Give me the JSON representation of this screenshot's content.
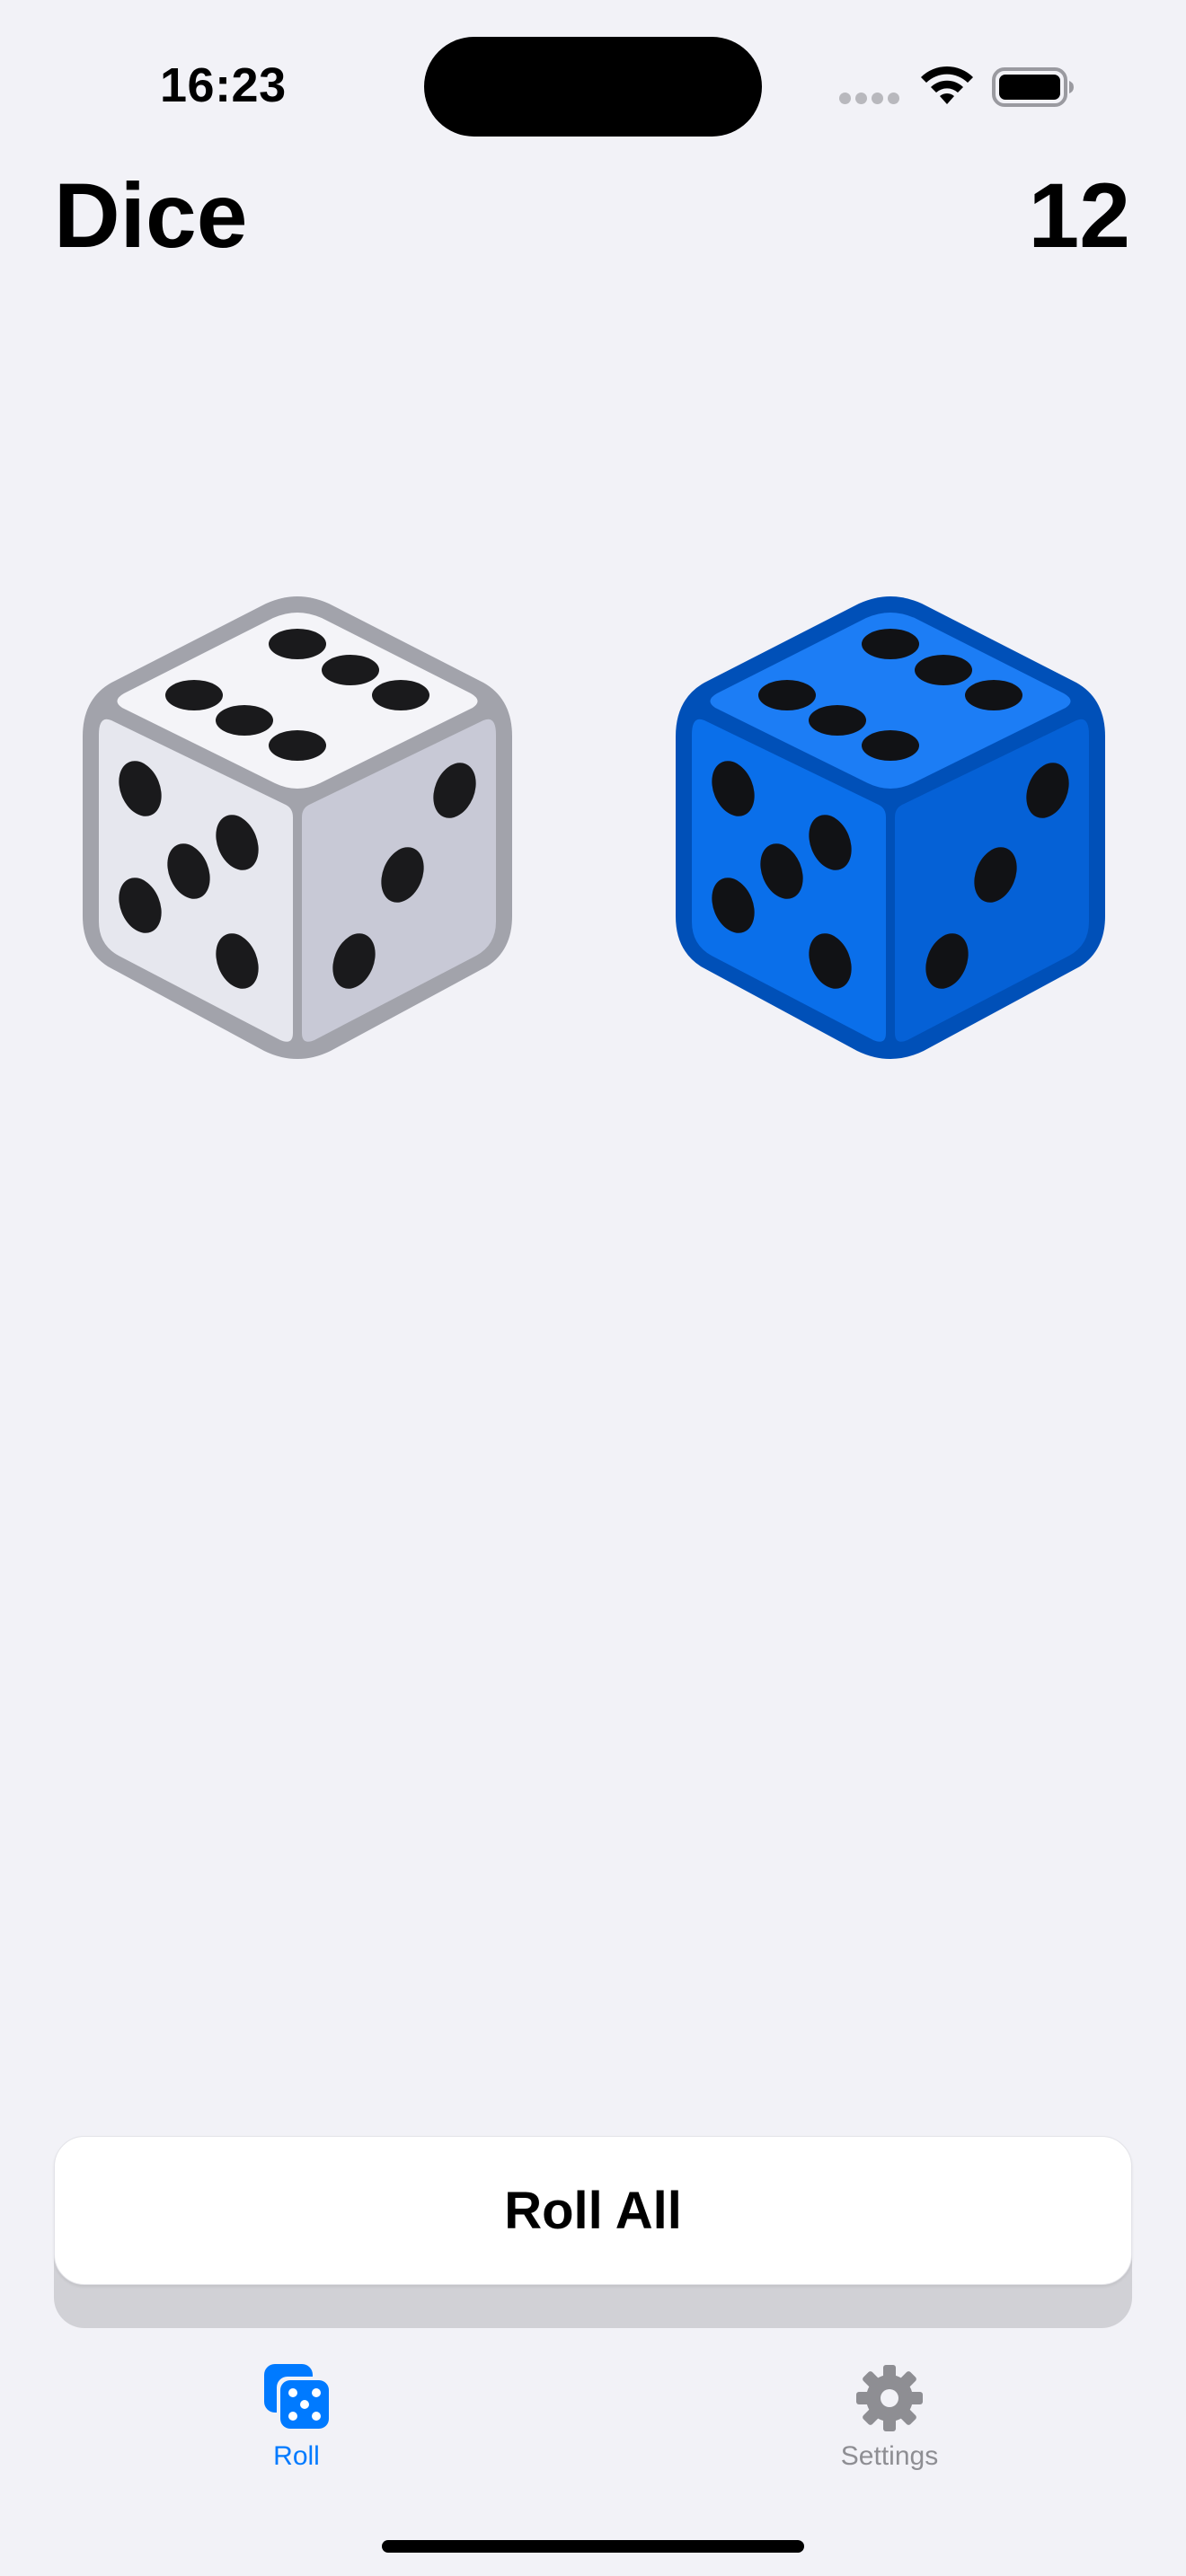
{
  "status_bar": {
    "time": "16:23"
  },
  "header": {
    "title": "Dice",
    "total": "12"
  },
  "dice": [
    {
      "color": "#FFFFFF",
      "outline": "#9A9BA3",
      "value": 6,
      "label": "white die"
    },
    {
      "color": "#0A6FEA",
      "outline": "#0050B8",
      "value": 6,
      "label": "blue die"
    }
  ],
  "actions": {
    "roll_all_label": "Roll All"
  },
  "tab_bar": {
    "tabs": [
      {
        "label": "Roll",
        "icon": "dice-icon",
        "selected": true
      },
      {
        "label": "Settings",
        "icon": "gear-icon",
        "selected": false
      }
    ]
  },
  "colors": {
    "accent": "#007AFF",
    "background": "#F2F2F7",
    "inactive_tab": "#8E8E93"
  }
}
